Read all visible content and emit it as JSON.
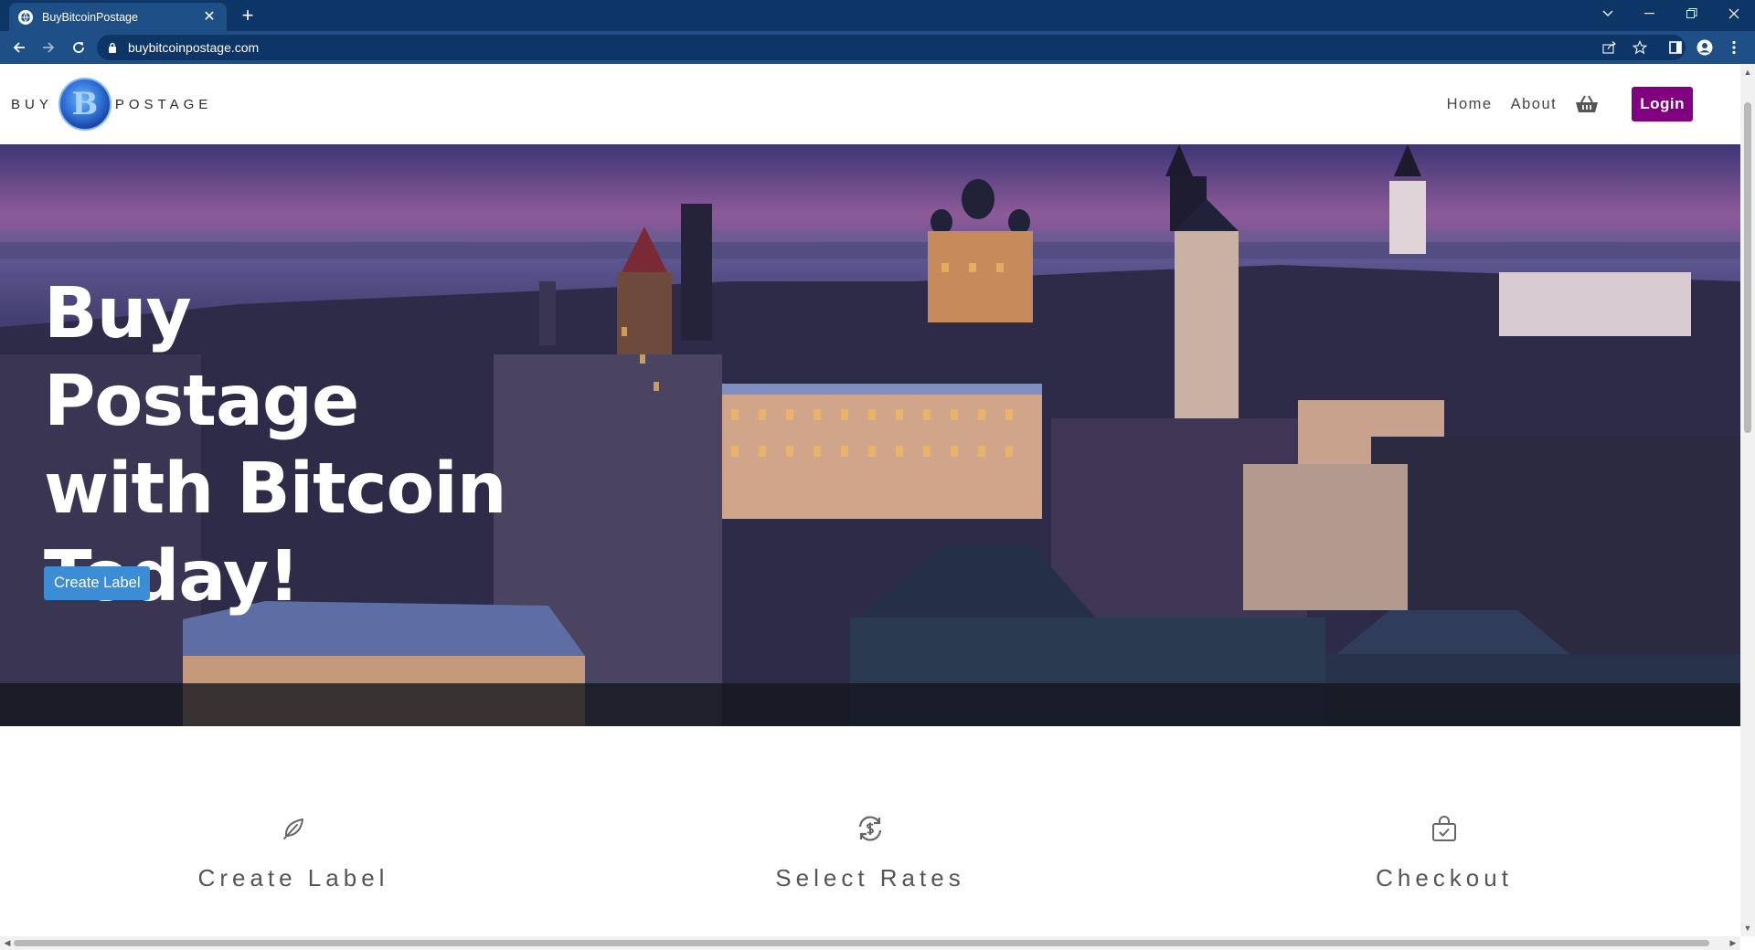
{
  "browser": {
    "tab_title": "BuyBitcoinPostage",
    "url": "buybitcoinpostage.com"
  },
  "header": {
    "logo_left": "BUY",
    "logo_right": "POSTAGE",
    "logo_coin_letter": "B",
    "nav": {
      "home": "Home",
      "about": "About",
      "login": "Login"
    },
    "login_color": "#800080"
  },
  "hero": {
    "title": "Buy Postage with Bitcoin Today!",
    "cta": "Create Label",
    "cta_color": "#3b8ed6"
  },
  "steps": [
    {
      "label": "Create Label",
      "icon": "feather-icon"
    },
    {
      "label": "Select Rates",
      "icon": "currency-exchange-icon"
    },
    {
      "label": "Checkout",
      "icon": "shopping-bag-check-icon"
    }
  ]
}
